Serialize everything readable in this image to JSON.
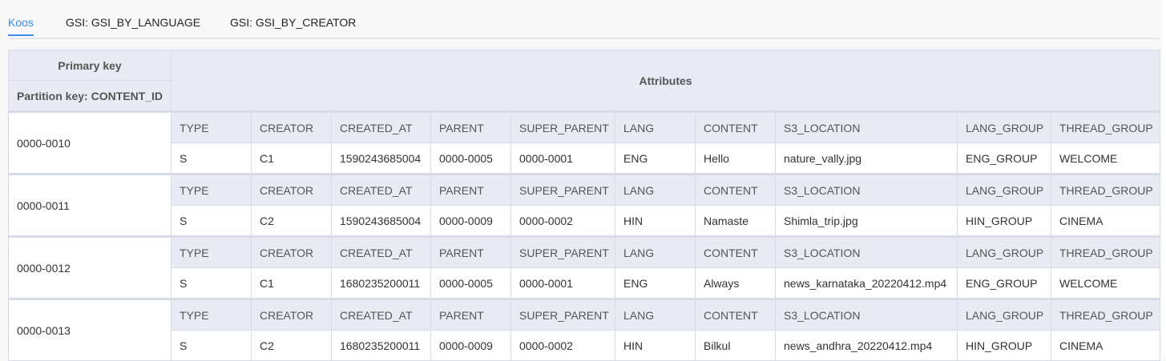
{
  "tabs": [
    {
      "label": "Koos",
      "active": true
    },
    {
      "label": "GSI: GSI_BY_LANGUAGE"
    },
    {
      "label": "GSI: GSI_BY_CREATOR"
    }
  ],
  "table": {
    "primary_key_header": "Primary key",
    "partition_key_header": "Partition key: CONTENT_ID",
    "attributes_header": "Attributes",
    "items": [
      {
        "id": "0000-0010",
        "names": [
          "TYPE",
          "CREATOR",
          "CREATED_AT",
          "PARENT",
          "SUPER_PARENT",
          "LANG",
          "CONTENT",
          "S3_LOCATION",
          "LANG_GROUP",
          "THREAD_GROUP"
        ],
        "values": [
          "S",
          "C1",
          "1590243685004",
          "0000-0005",
          "0000-0001",
          "ENG",
          "Hello",
          "nature_vally.jpg",
          "ENG_GROUP",
          "WELCOME"
        ]
      },
      {
        "id": "0000-0011",
        "names": [
          "TYPE",
          "CREATOR",
          "CREATED_AT",
          "PARENT",
          "SUPER_PARENT",
          "LANG",
          "CONTENT",
          "S3_LOCATION",
          "LANG_GROUP",
          "THREAD_GROUP"
        ],
        "values": [
          "S",
          "C2",
          "1590243685004",
          "0000-0009",
          "0000-0002",
          "HIN",
          "Namaste",
          "Shimla_trip.jpg",
          "HIN_GROUP",
          "CINEMA"
        ]
      },
      {
        "id": "0000-0012",
        "names": [
          "TYPE",
          "CREATOR",
          "CREATED_AT",
          "PARENT",
          "SUPER_PARENT",
          "LANG",
          "CONTENT",
          "S3_LOCATION",
          "LANG_GROUP",
          "THREAD_GROUP"
        ],
        "values": [
          "S",
          "C1",
          "1680235200011",
          "0000-0005",
          "0000-0001",
          "ENG",
          "Always",
          "news_karnataka_20220412.mp4",
          "ENG_GROUP",
          "WELCOME"
        ]
      },
      {
        "id": "0000-0013",
        "names": [
          "TYPE",
          "CREATOR",
          "CREATED_AT",
          "PARENT",
          "SUPER_PARENT",
          "LANG",
          "CONTENT",
          "S3_LOCATION",
          "LANG_GROUP",
          "THREAD_GROUP"
        ],
        "values": [
          "S",
          "C2",
          "1680235200011",
          "0000-0009",
          "0000-0002",
          "HIN",
          "Bilkul",
          "news_andhra_20220412.mp4",
          "HIN_GROUP",
          "CINEMA"
        ]
      }
    ]
  }
}
